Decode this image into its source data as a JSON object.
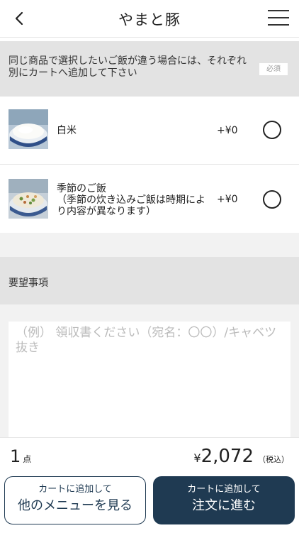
{
  "header": {
    "title": "やまと豚",
    "back_icon": "chevron-left-icon",
    "menu_icon": "hamburger-menu-icon"
  },
  "notice": {
    "text": "同じ商品で選択したいご飯が違う場合には、それぞれ別にカートへ追加して下さい",
    "required_label": "必須"
  },
  "rice_options": [
    {
      "name": "白米",
      "sub": "",
      "price": "+¥0",
      "selected": false
    },
    {
      "name": "季節のご飯",
      "sub": "（季節の炊き込みご飯は時期により内容が異なります）",
      "price": "+¥0",
      "selected": false
    }
  ],
  "requests": {
    "title": "要望事項",
    "placeholder": "（例） 領収書ください（宛名：〇〇）/キャベツ抜き"
  },
  "footer": {
    "quantity": "1",
    "quantity_unit": "点",
    "yen_sign": "¥",
    "total": "2,072",
    "tax_label": "（税込）",
    "btn_continue_line1": "カートに追加して",
    "btn_continue_line2": "他のメニューを見る",
    "btn_order_line1": "カートに追加して",
    "btn_order_line2": "注文に進む"
  },
  "colors": {
    "primary": "#1f3a52",
    "section_bg": "#e3e3e3"
  }
}
